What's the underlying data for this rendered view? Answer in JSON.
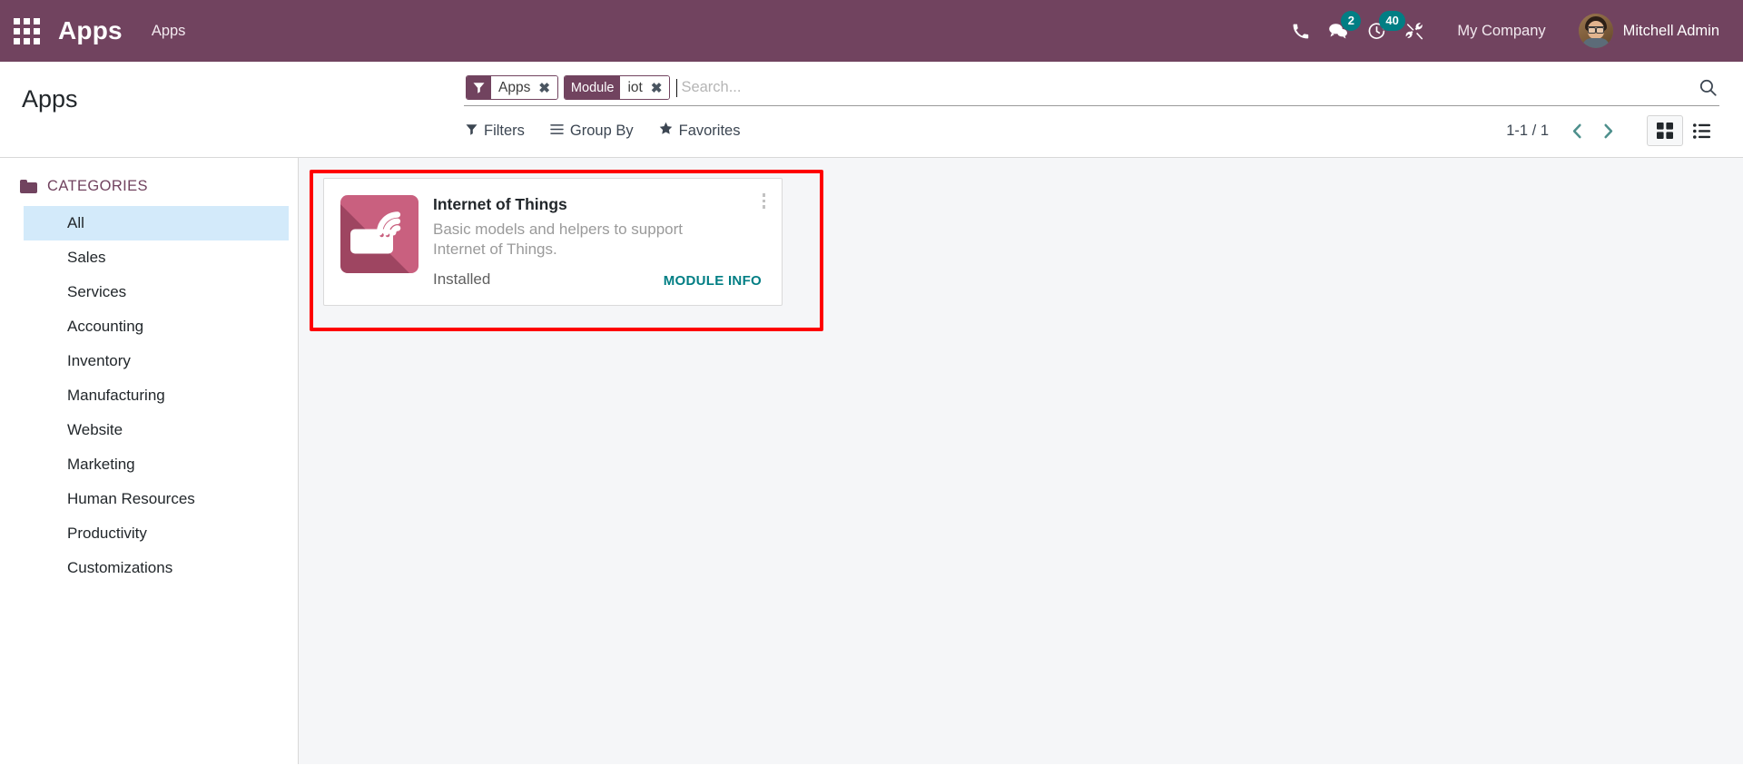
{
  "navbar": {
    "apps_grid_icon": "apps-grid-icon",
    "brand": "Apps",
    "menu_item": "Apps",
    "icons": [
      {
        "name": "phone-icon",
        "badge": null
      },
      {
        "name": "messages-icon",
        "badge": "2"
      },
      {
        "name": "activities-clock-icon",
        "badge": "40"
      },
      {
        "name": "developer-tools-icon",
        "badge": null
      }
    ],
    "company": "My Company",
    "user_name": "Mitchell Admin",
    "avatar_alt": "user-avatar",
    "background_color": "#71435f",
    "badge_color": "#017e84"
  },
  "control_panel": {
    "title": "Apps",
    "search": {
      "placeholder": "Search...",
      "value": "",
      "search_icon": "search-icon",
      "facets": [
        {
          "icon": "filter-funnel-icon",
          "label": null,
          "value": "Apps",
          "remove": "✖"
        },
        {
          "icon": null,
          "label": "Module",
          "value": "iot",
          "remove": "✖"
        }
      ]
    },
    "dropdowns": [
      {
        "icon": "filter-funnel-icon",
        "label": "Filters"
      },
      {
        "icon": "group-by-lines-icon",
        "label": "Group By"
      },
      {
        "icon": "star-icon",
        "label": "Favorites"
      }
    ],
    "pager": {
      "value": "1-1 / 1",
      "prev_icon": "chevron-left-icon",
      "next_icon": "chevron-right-icon"
    },
    "views": [
      {
        "name": "kanban-view",
        "icon": "kanban-grid-icon",
        "active": true
      },
      {
        "name": "list-view",
        "icon": "list-icon",
        "active": false
      }
    ]
  },
  "sidebar": {
    "header": "CATEGORIES",
    "header_icon": "folder-icon",
    "items": [
      {
        "label": "All",
        "active": true
      },
      {
        "label": "Sales",
        "active": false
      },
      {
        "label": "Services",
        "active": false
      },
      {
        "label": "Accounting",
        "active": false
      },
      {
        "label": "Inventory",
        "active": false
      },
      {
        "label": "Manufacturing",
        "active": false
      },
      {
        "label": "Website",
        "active": false
      },
      {
        "label": "Marketing",
        "active": false
      },
      {
        "label": "Human Resources",
        "active": false
      },
      {
        "label": "Productivity",
        "active": false
      },
      {
        "label": "Customizations",
        "active": false
      }
    ]
  },
  "main": {
    "highlight_color": "#fe0000",
    "cards": [
      {
        "title": "Internet of Things",
        "description": "Basic models and helpers to support Internet of Things.",
        "state": "Installed",
        "action_label": "MODULE INFO",
        "icon_name": "internet-of-things-app-icon",
        "kebab_icon": "kebab-menu-icon"
      }
    ]
  }
}
